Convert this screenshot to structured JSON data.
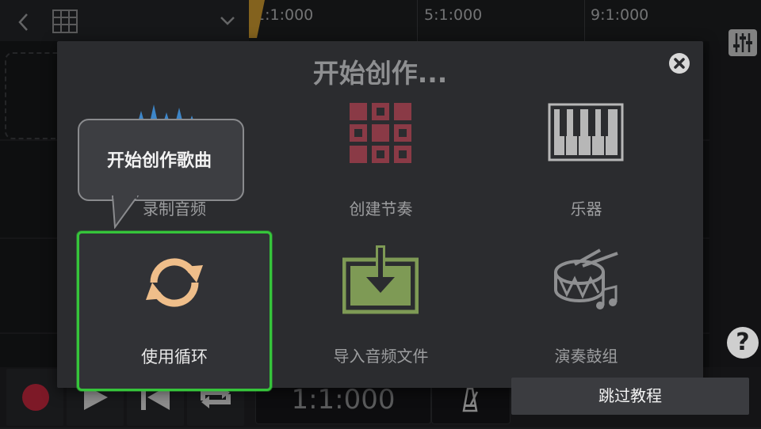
{
  "timeline": {
    "ruler_labels": [
      "1:1:000",
      "5:1:000",
      "9:1:000"
    ]
  },
  "transport": {
    "time_display": "1:1:000"
  },
  "dialog": {
    "title": "开始创作...",
    "options": [
      {
        "label": "录制音频",
        "icon": "waveform-icon"
      },
      {
        "label": "创建节奏",
        "icon": "drum-pad-grid-icon"
      },
      {
        "label": "乐器",
        "icon": "piano-keys-icon"
      },
      {
        "label": "使用循环",
        "icon": "loop-arrows-icon"
      },
      {
        "label": "导入音频文件",
        "icon": "import-file-icon"
      },
      {
        "label": "演奏鼓组",
        "icon": "drum-kit-icon"
      }
    ]
  },
  "tooltip": {
    "text": "开始创作歌曲"
  },
  "skip_button": {
    "label": "跳过教程"
  },
  "help_button": {
    "label": "?"
  },
  "colors": {
    "highlight": "#36c53b",
    "record": "#c1273d",
    "loop_icon": "#efbe8a",
    "beat_icon": "#8a3a46",
    "import_icon": "#7e9a55",
    "playhead": "#c9972e"
  }
}
